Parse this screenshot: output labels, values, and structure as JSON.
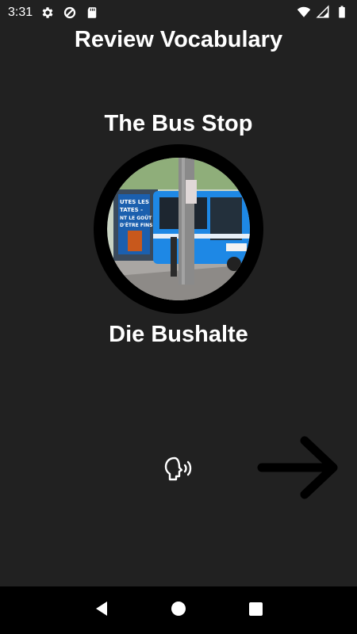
{
  "status_bar": {
    "time": "3:31",
    "left_icons": [
      "settings-icon",
      "data-saver-icon",
      "sd-card-icon"
    ],
    "right_icons": [
      "wifi-icon",
      "signal-icon",
      "battery-icon"
    ]
  },
  "header": {
    "title": "Review Vocabulary"
  },
  "card": {
    "english_word": "The Bus Stop",
    "image_icon": "bus-stop-photo",
    "image_text": {
      "poster_line1": "UTES LES",
      "poster_line2": "TATES -",
      "poster_line3": "NT LE GOÛT",
      "poster_line4": "D'ÊTRE FINS."
    },
    "german_word": "Die Bushalte"
  },
  "actions": {
    "speak_icon": "speak-icon",
    "next_icon": "arrow-right-icon"
  },
  "nav_bar": {
    "icons": [
      "back-icon",
      "home-icon",
      "recents-icon"
    ]
  },
  "colors": {
    "background": "#212121",
    "text": "#ffffff",
    "ring": "#000000",
    "arrow": "#000000",
    "nav_bar": "#000000",
    "bus_blue": "#1e88e5"
  }
}
